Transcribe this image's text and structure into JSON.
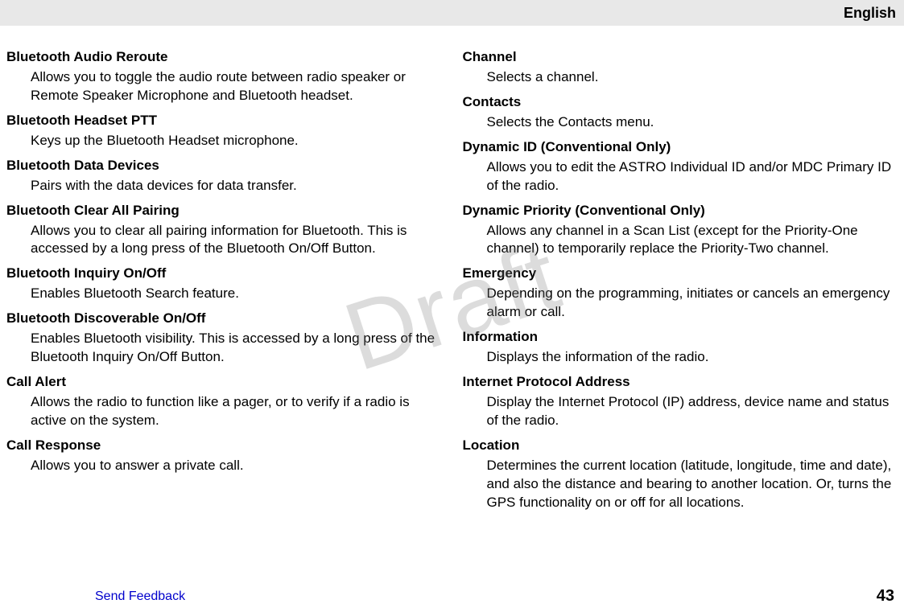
{
  "header": {
    "language": "English"
  },
  "watermark": "Draft",
  "footer": {
    "feedback": "Send Feedback",
    "page": "43"
  },
  "columns": {
    "left": [
      {
        "term": "Bluetooth Audio Reroute",
        "desc": "Allows you to toggle the audio route between radio speaker or Remote Speaker Microphone and Bluetooth headset."
      },
      {
        "term": "Bluetooth Headset PTT",
        "desc": "Keys up the Bluetooth Headset microphone."
      },
      {
        "term": "Bluetooth Data Devices",
        "desc": "Pairs with the data devices for data transfer."
      },
      {
        "term": "Bluetooth Clear All Pairing",
        "desc": "Allows you to clear all pairing information for Bluetooth. This is accessed by a long press of the Bluetooth On/Off Button."
      },
      {
        "term": "Bluetooth Inquiry On/Off",
        "desc": "Enables Bluetooth Search feature."
      },
      {
        "term": "Bluetooth Discoverable On/Off",
        "desc": "Enables Bluetooth visibility. This is accessed by a long press of the Bluetooth Inquiry On/Off Button."
      },
      {
        "term": "Call Alert",
        "desc": "Allows the radio to function like a pager, or to verify if a radio is active on the system."
      },
      {
        "term": "Call Response",
        "desc": "Allows you to answer a private call."
      }
    ],
    "right": [
      {
        "term": "Channel",
        "desc": "Selects a channel."
      },
      {
        "term": "Contacts",
        "desc": "Selects the Contacts menu."
      },
      {
        "term": "Dynamic ID (Conventional Only)",
        "desc": "Allows you to edit the ASTRO Individual ID and/or MDC Primary ID of the radio."
      },
      {
        "term": "Dynamic Priority (Conventional Only)",
        "desc": "Allows any channel in a Scan List (except for the Priority-One channel) to temporarily replace the Priority-Two channel."
      },
      {
        "term": "Emergency",
        "desc": "Depending on the programming, initiates or cancels an emergency alarm or call."
      },
      {
        "term": "Information",
        "desc": "Displays the information of the radio."
      },
      {
        "term": "Internet Protocol Address",
        "desc": "Display the Internet Protocol (IP) address, device name and status of the radio."
      },
      {
        "term": "Location",
        "desc": "Determines the current location (latitude, longitude, time and date), and also the distance and bearing to another location. Or, turns the GPS functionality on or off for all locations."
      }
    ]
  }
}
